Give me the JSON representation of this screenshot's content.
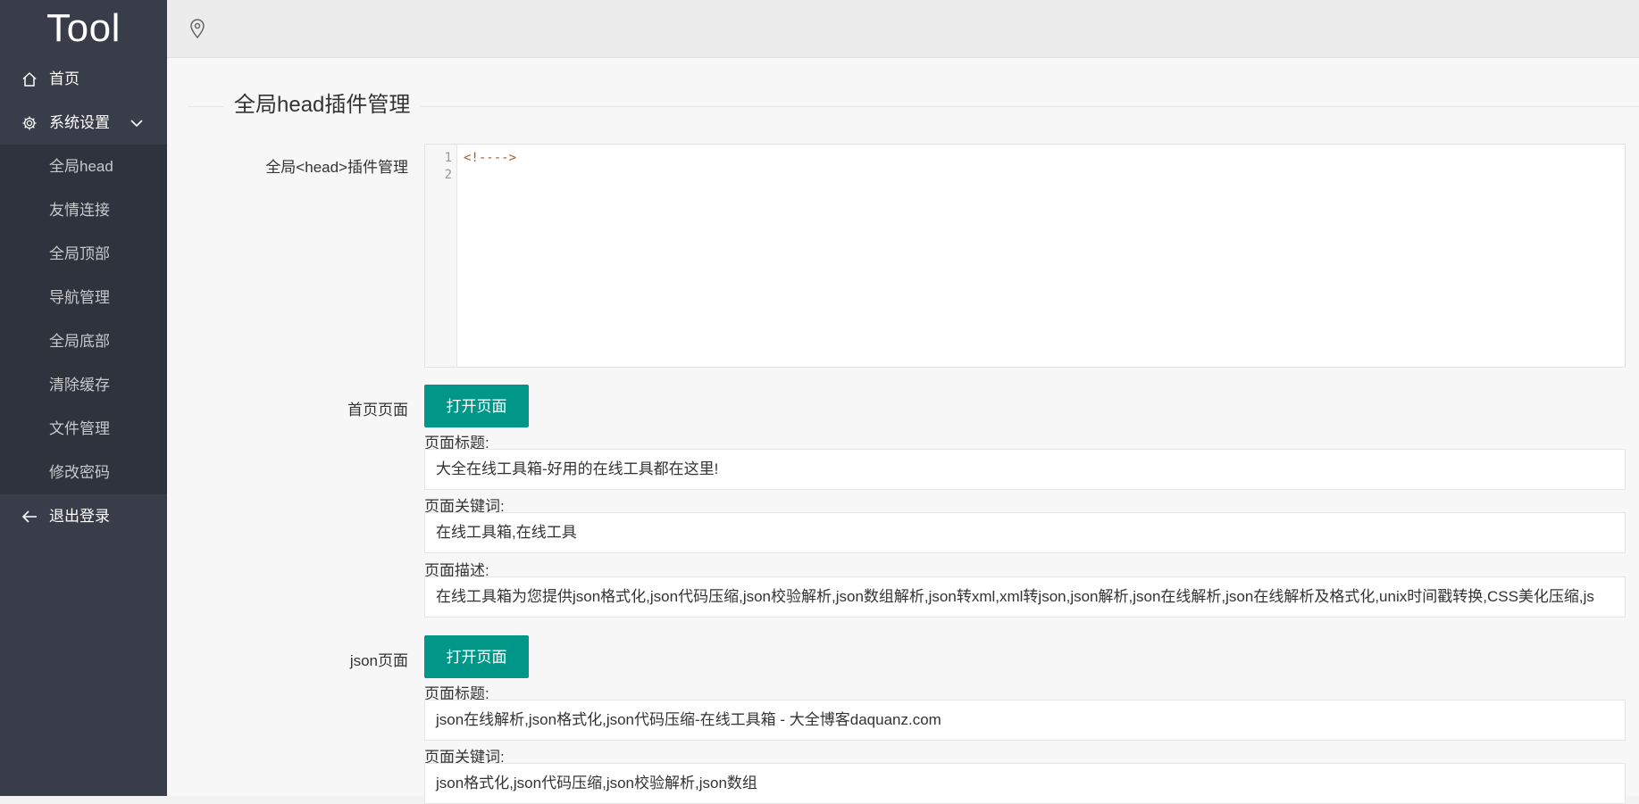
{
  "app": {
    "title": "Tool"
  },
  "sidebar": {
    "home": {
      "label": "首页",
      "icon": "home-icon"
    },
    "settings": {
      "label": "系统设置",
      "icon": "gear-icon",
      "expanded": true
    },
    "sub_items": [
      {
        "label": "全局head"
      },
      {
        "label": "友情连接"
      },
      {
        "label": "全局顶部"
      },
      {
        "label": "导航管理"
      },
      {
        "label": "全局底部"
      },
      {
        "label": "清除缓存"
      },
      {
        "label": "文件管理"
      },
      {
        "label": "修改密码"
      }
    ],
    "logout": {
      "label": "退出登录",
      "icon": "arrow-left-icon"
    }
  },
  "main": {
    "section_title": "全局head插件管理",
    "head_label": "全局<head>插件管理",
    "editor": {
      "line_numbers": [
        "1",
        "2"
      ],
      "code": "<!---->"
    },
    "pages": [
      {
        "label": "首页页面",
        "button": "打开页面",
        "title_label": "页面标题:",
        "title_value": "大全在线工具箱-好用的在线工具都在这里!",
        "keywords_label": "页面关键词:",
        "keywords_value": "在线工具箱,在线工具",
        "desc_label": "页面描述:",
        "desc_value": "在线工具箱为您提供json格式化,json代码压缩,json校验解析,json数组解析,json转xml,xml转json,json解析,json在线解析,json在线解析及格式化,unix时间戳转换,CSS美化压缩,js"
      },
      {
        "label": "json页面",
        "button": "打开页面",
        "title_label": "页面标题:",
        "title_value": "json在线解析,json格式化,json代码压缩-在线工具箱 - 大全博客daquanz.com",
        "keywords_label": "页面关键词:",
        "keywords_value": "json格式化,json代码压缩,json校验解析,json数组"
      }
    ]
  },
  "colors": {
    "sidebar_bg": "#393d49",
    "subnav_bg": "#2f333d",
    "accent": "#009688"
  }
}
